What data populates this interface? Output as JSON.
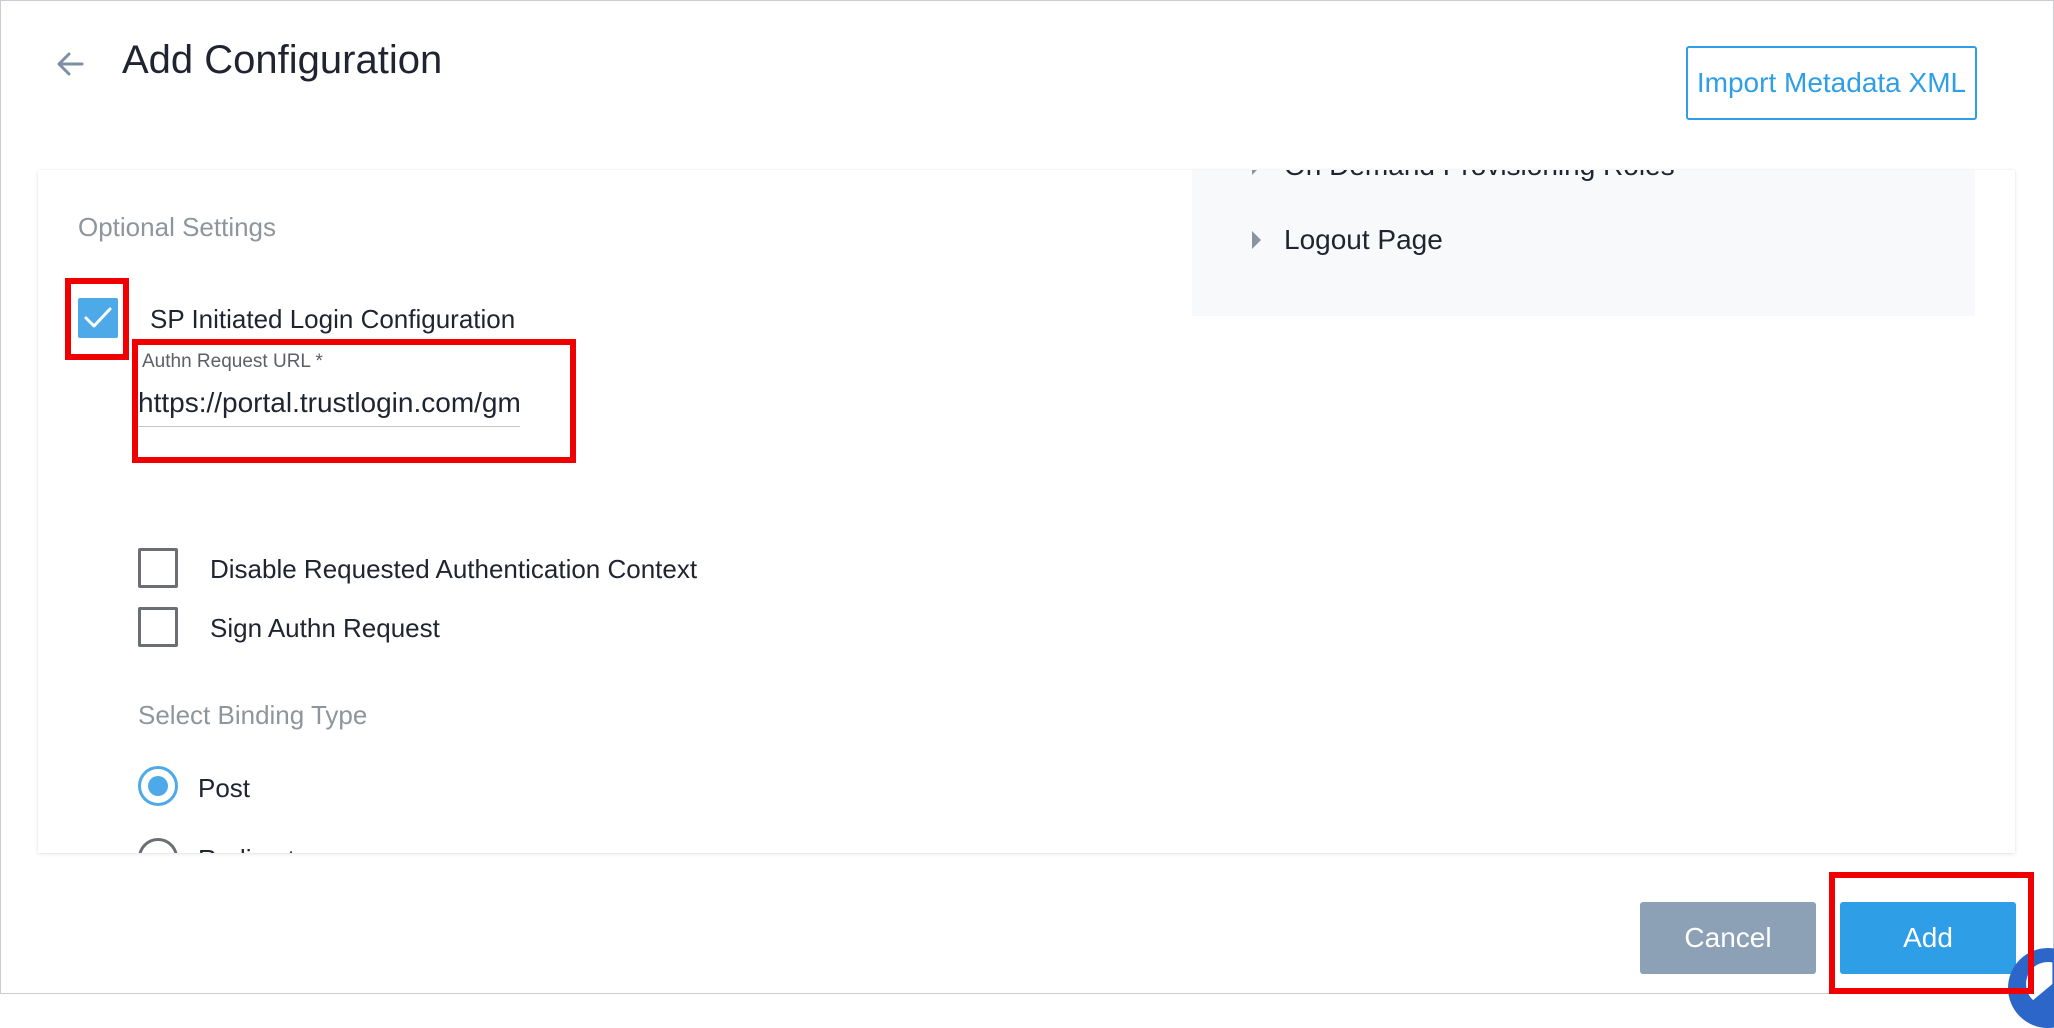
{
  "header": {
    "title": "Add Configuration",
    "import_button_label": "Import Metadata XML"
  },
  "right_panel": {
    "items": [
      {
        "label": "On Demand Provisioning Roles"
      },
      {
        "label": "Logout Page"
      }
    ]
  },
  "optional_settings": {
    "section_label": "Optional Settings",
    "sp_initiated_login": {
      "label": "SP Initiated Login Configuration",
      "checked": true
    },
    "authn_request_url": {
      "label": "Authn Request URL *",
      "value": "https://portal.trustlogin.com/gm"
    },
    "disable_requested_auth_context": {
      "label": "Disable Requested Authentication Context",
      "checked": false
    },
    "sign_authn_request": {
      "label": "Sign Authn Request",
      "checked": false
    },
    "binding_type": {
      "label": "Select Binding Type",
      "options": [
        {
          "label": "Post",
          "selected": true
        },
        {
          "label": "Redirect",
          "selected": false
        }
      ]
    }
  },
  "footer": {
    "cancel_label": "Cancel",
    "add_label": "Add"
  },
  "colors": {
    "accent": "#2e9ee6",
    "checkbox_fill": "#4ea9e8",
    "cancel_bg": "#8ca1b5",
    "highlight": "#f00000"
  }
}
